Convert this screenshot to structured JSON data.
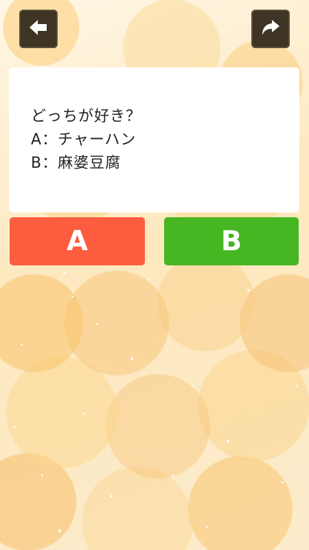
{
  "toolbar": {
    "back_icon": "arrow-left-icon",
    "share_icon": "share-arrow-icon"
  },
  "question": {
    "lines": [
      "どっちが好き？",
      "A：チャーハン",
      "B：麻婆豆腐"
    ]
  },
  "choices": {
    "a_label": "A",
    "b_label": "B",
    "a_color": "#fb5d3e",
    "b_color": "#47b623"
  },
  "colors": {
    "nav_button": "#3d3424",
    "card": "#ffffff"
  }
}
